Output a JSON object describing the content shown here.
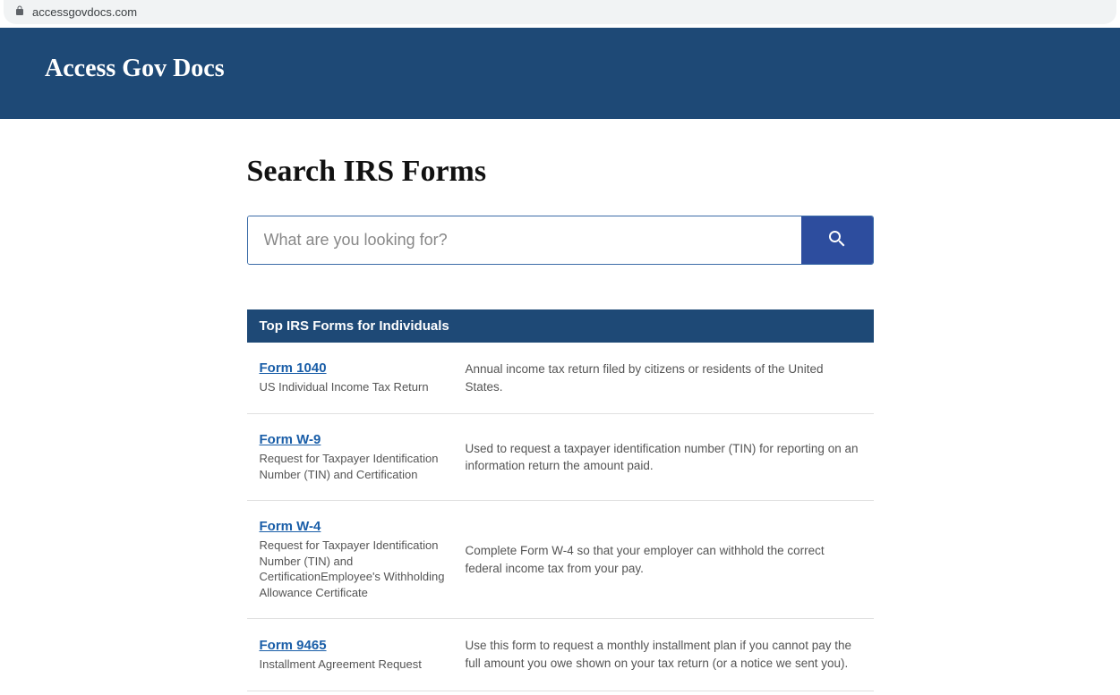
{
  "browser": {
    "url": "accessgovdocs.com"
  },
  "header": {
    "site_name": "Access Gov Docs"
  },
  "search": {
    "heading": "Search IRS Forms",
    "placeholder": "What are you looking for?"
  },
  "forms_section": {
    "title": "Top IRS Forms for Individuals",
    "items": [
      {
        "name": "Form 1040",
        "subtitle": "US Individual Income Tax Return",
        "description": "Annual income tax return filed by citizens or residents of the United States."
      },
      {
        "name": "Form W-9",
        "subtitle": "Request for Taxpayer Identification Number (TIN) and Certification",
        "description": "Used to request a taxpayer identification number (TIN) for reporting on an information return the amount paid."
      },
      {
        "name": "Form W-4",
        "subtitle": "Request for Taxpayer Identification Number (TIN) and CertificationEmployee's Withholding Allowance Certificate",
        "description": "Complete Form W-4 so that your employer can withhold the correct federal income tax from your pay."
      },
      {
        "name": "Form 9465",
        "subtitle": "Installment Agreement Request",
        "description": "Use this form to request a monthly installment plan if you cannot pay the full amount you owe shown on your tax return (or a notice we sent you)."
      }
    ]
  }
}
